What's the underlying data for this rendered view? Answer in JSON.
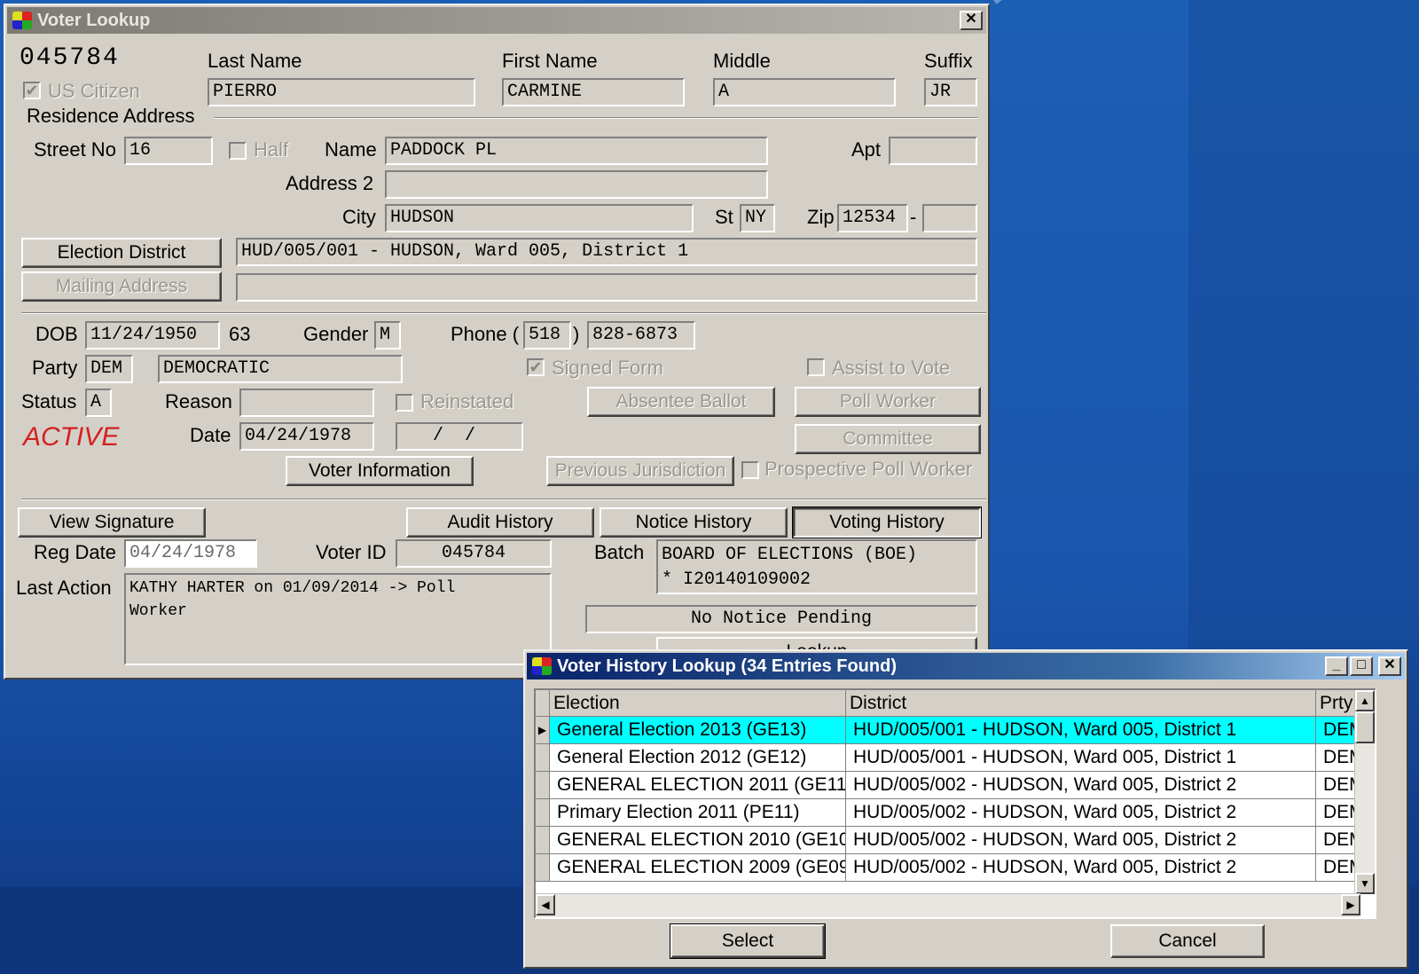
{
  "colors": {
    "selected_row": "#00ffff",
    "status_active": "#d42020",
    "title_active": "#0a246a"
  },
  "main": {
    "title": "Voter Lookup",
    "voter_number": "045784",
    "labels": {
      "last_name": "Last Name",
      "first_name": "First Name",
      "middle": "Middle",
      "suffix": "Suffix",
      "us_citizen": "US Citizen",
      "residence_address": "Residence Address",
      "street_no": "Street No",
      "half": "Half",
      "name": "Name",
      "apt": "Apt",
      "address2": "Address 2",
      "city": "City",
      "st": "St",
      "zip": "Zip",
      "zip_dash": "-",
      "dob": "DOB",
      "gender": "Gender",
      "phone": "Phone (",
      "phone_close": ")",
      "party": "Party",
      "signed_form": "Signed Form",
      "assist_to_vote": "Assist to Vote",
      "status": "Status",
      "reason": "Reason",
      "reinstated": "Reinstated",
      "date": "Date",
      "prospective_poll_worker": "Prospective Poll Worker",
      "reg_date": "Reg Date",
      "voter_id": "Voter ID",
      "batch": "Batch",
      "last_action": "Last Action"
    },
    "values": {
      "last_name": "PIERRO",
      "first_name": "CARMINE",
      "middle": "A",
      "suffix": "JR",
      "street_no": "16",
      "street_name": "PADDOCK PL",
      "apt": "",
      "address2": "",
      "city": "HUDSON",
      "state": "NY",
      "zip": "12534",
      "zip4": "",
      "election_district": "HUD/005/001 - HUDSON, Ward 005, District 1",
      "mailing_address": "",
      "dob": "11/24/1950",
      "age": "63",
      "gender": "M",
      "area_code": "518",
      "phone": "828-6873",
      "party_code": "DEM",
      "party_name": "DEMOCRATIC",
      "status_code": "A",
      "status_text": "ACTIVE",
      "reason": "",
      "date": "04/24/1978",
      "date2": " /  /",
      "reg_date": "04/24/1978",
      "voter_id": "045784",
      "batch": "BOARD OF ELECTIONS (BOE)\n* I20140109002",
      "notice": "No Notice Pending",
      "last_action": "KATHY HARTER on 01/09/2014 -> Poll\nWorker"
    },
    "checks": {
      "us_citizen": "✔",
      "signed_form": "✔"
    },
    "buttons": {
      "election_district": "Election District",
      "mailing_address": "Mailing Address",
      "absentee_ballot": "Absentee Ballot",
      "poll_worker": "Poll Worker",
      "committee": "Committee",
      "voter_information": "Voter Information",
      "previous_jurisdiction": "Previous Jurisdiction",
      "view_signature": "View Signature",
      "audit_history": "Audit History",
      "notice_history": "Notice History",
      "voting_history": "Voting History",
      "lookup": "Lookup"
    },
    "close": "✕"
  },
  "history": {
    "title": "Voter History Lookup (34 Entries Found)",
    "controls": {
      "minimize": "_",
      "maximize": "□",
      "close": "✕"
    },
    "columns": [
      "Election",
      "District",
      "Prty"
    ],
    "rows": [
      {
        "election": "General Election 2013 (GE13)",
        "district": "HUD/005/001 - HUDSON, Ward 005, District 1",
        "party": "DEM"
      },
      {
        "election": "General Election 2012 (GE12)",
        "district": "HUD/005/001 - HUDSON, Ward 005, District 1",
        "party": "DEM"
      },
      {
        "election": "GENERAL ELECTION 2011 (GE11",
        "district": "HUD/005/002 - HUDSON, Ward 005, District 2",
        "party": "DEM"
      },
      {
        "election": "Primary Election 2011 (PE11)",
        "district": "HUD/005/002 - HUDSON, Ward 005, District 2",
        "party": "DEM"
      },
      {
        "election": "GENERAL ELECTION 2010 (GE10",
        "district": "HUD/005/002 - HUDSON, Ward 005, District 2",
        "party": "DEM"
      },
      {
        "election": "GENERAL ELECTION 2009 (GE09",
        "district": "HUD/005/002 - HUDSON, Ward 005, District 2",
        "party": "DEM"
      }
    ],
    "selected_marker": "▶",
    "scroll": {
      "up": "▲",
      "down": "▼",
      "left": "◀",
      "right": "▶"
    },
    "buttons": {
      "select": "Select",
      "cancel": "Cancel"
    }
  }
}
